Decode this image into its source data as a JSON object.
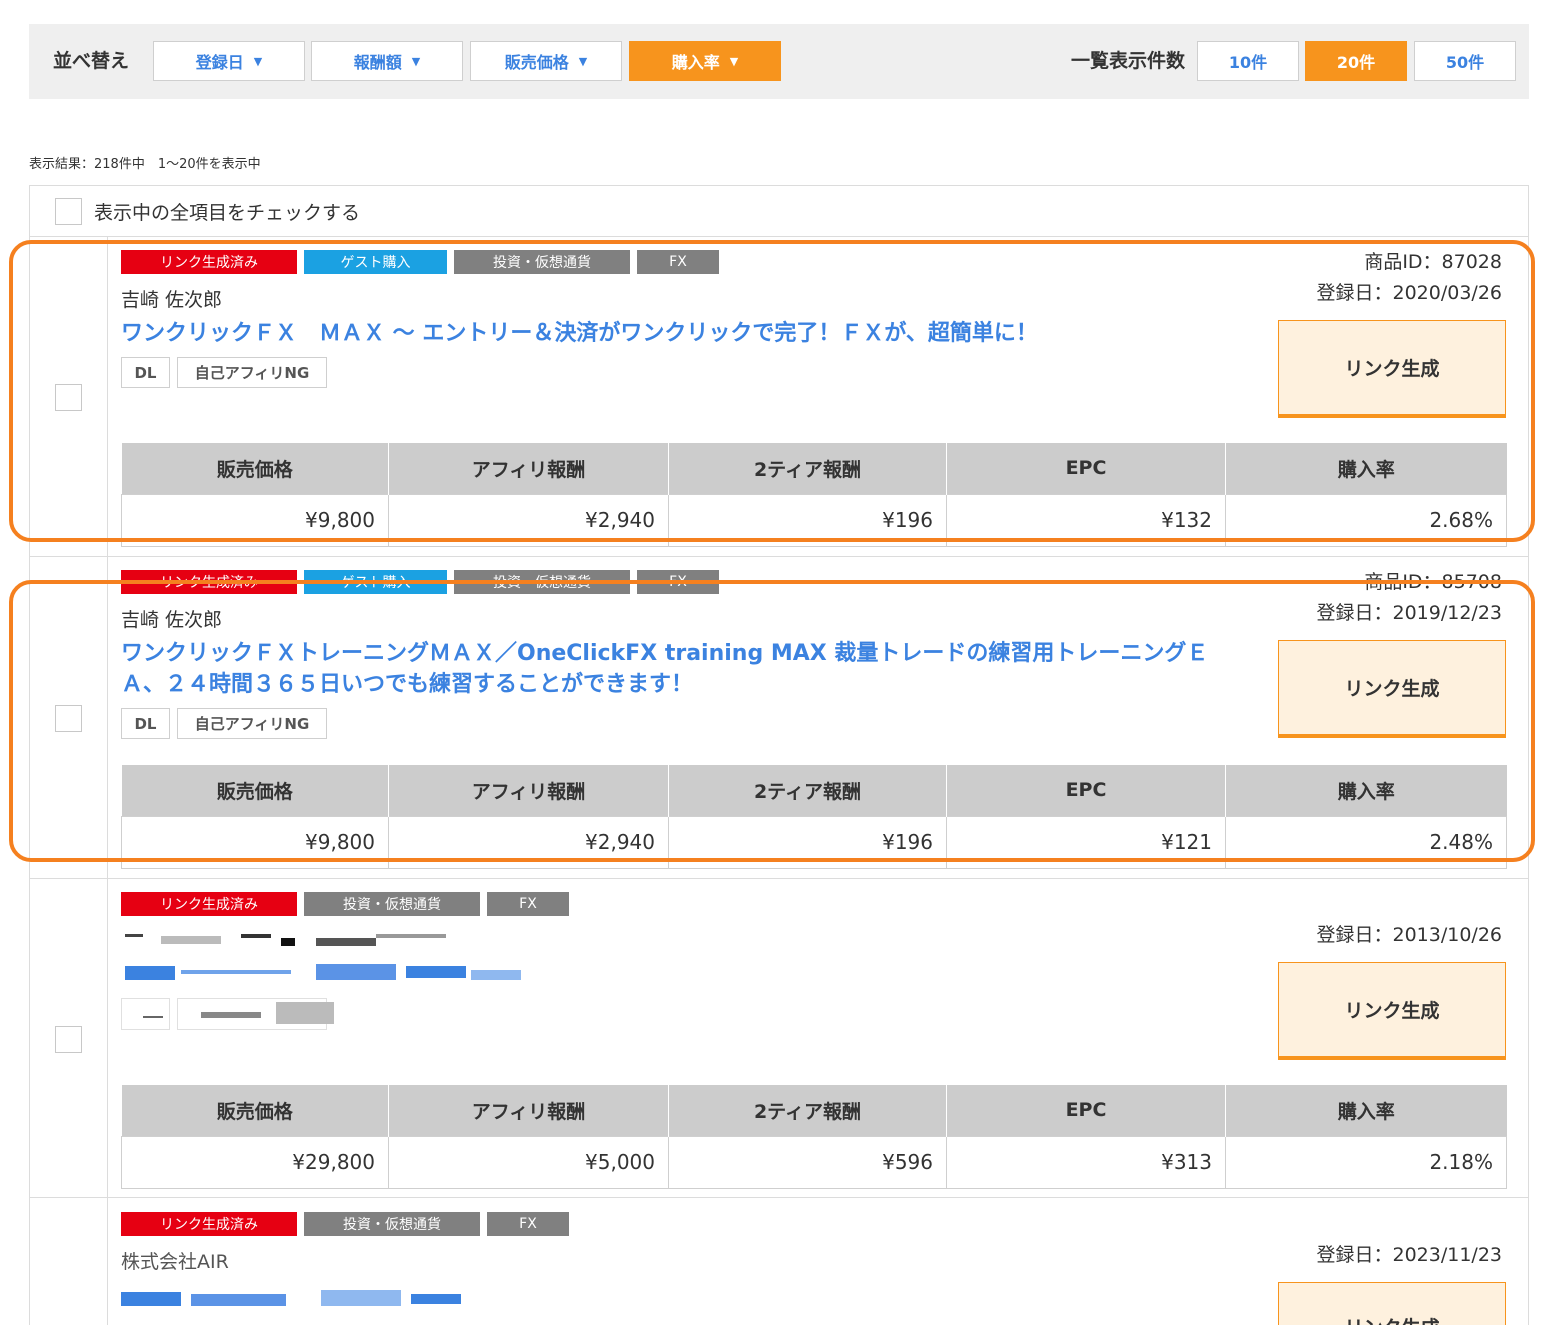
{
  "toolbar": {
    "sort_label": "並べ替え",
    "sort_buttons": [
      {
        "label": "登録日",
        "active": false
      },
      {
        "label": "報酬額",
        "active": false
      },
      {
        "label": "販売価格",
        "active": false
      },
      {
        "label": "購入率",
        "active": true
      }
    ],
    "per_page_label": "一覧表示件数",
    "per_page_buttons": [
      {
        "label": "10件",
        "active": false
      },
      {
        "label": "20件",
        "active": true
      },
      {
        "label": "50件",
        "active": false
      }
    ],
    "arrow": "▼"
  },
  "result_text": "表示結果：218件中　1～20件を表示中",
  "check_all_label": "表示中の全項目をチェックする",
  "stat_headers": [
    "販売価格",
    "アフィリ報酬",
    "2ティア報酬",
    "EPC",
    "購入率"
  ],
  "link_button_label": "リンク生成",
  "items": [
    {
      "tags": [
        "リンク生成済み",
        "ゲスト購入",
        "投資・仮想通貨",
        "FX"
      ],
      "product_id": "商品ID：87028",
      "registered": "登録日：2020/03/26",
      "seller": "吉崎 佐次郎",
      "title": "ワンクリックＦＸ　ＭＡＸ ～ エントリー＆決済がワンクリックで完了！ＦＸが、超簡単に！",
      "badges": [
        "DL",
        "自己アフィリNG"
      ],
      "stats": [
        "¥9,800",
        "¥2,940",
        "¥196",
        "¥132",
        "2.68%"
      ]
    },
    {
      "tags": [
        "リンク生成済み",
        "ゲスト購入",
        "投資・仮想通貨",
        "FX"
      ],
      "product_id": "商品ID：85708",
      "registered": "登録日：2019/12/23",
      "seller": "吉崎 佐次郎",
      "title": "ワンクリックＦＸトレーニングＭＡＸ／OneClickFX training MAX 裁量トレードの練習用トレーニングＥＡ、２４時間３６５日いつでも練習することができます！",
      "badges": [
        "DL",
        "自己アフィリNG"
      ],
      "stats": [
        "¥9,800",
        "¥2,940",
        "¥196",
        "¥121",
        "2.48%"
      ]
    },
    {
      "tags": [
        "リンク生成済み",
        "投資・仮想通貨",
        "FX"
      ],
      "registered": "登録日：2013/10/26",
      "stats": [
        "¥29,800",
        "¥5,000",
        "¥596",
        "¥313",
        "2.18%"
      ]
    },
    {
      "tags": [
        "リンク生成済み",
        "投資・仮想通貨",
        "FX"
      ],
      "registered": "登録日：2023/11/23",
      "seller": "株式会社AIR"
    }
  ],
  "colors": {
    "accent_orange": "#f7941d",
    "highlight_orange": "#f5801f",
    "link_blue": "#3b82e0",
    "tag_red": "#e60012",
    "tag_blue": "#1ba1e2",
    "tag_gray": "#808080"
  }
}
